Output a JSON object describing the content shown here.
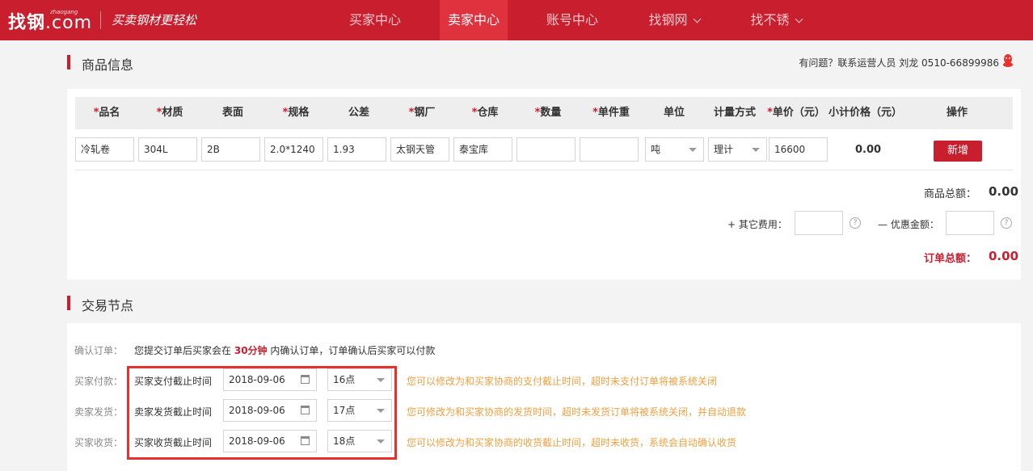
{
  "nav": {
    "logo": "找钢",
    "logo_com": ".com",
    "logo_sub": "zhaogang",
    "slogan": "买卖钢材更轻松",
    "items": [
      {
        "label": "买家中心"
      },
      {
        "label": "卖家中心"
      },
      {
        "label": "账号中心"
      },
      {
        "label": "找钢网"
      },
      {
        "label": "找不锈"
      }
    ]
  },
  "product_section": {
    "title": "商品信息",
    "contact": "有问题？联系运营人员 刘龙 0510-66899986"
  },
  "table": {
    "required_mark": "*",
    "headers": [
      {
        "label": "品名",
        "required": true
      },
      {
        "label": "材质",
        "required": true
      },
      {
        "label": "表面",
        "required": false
      },
      {
        "label": "规格",
        "required": true
      },
      {
        "label": "公差",
        "required": false
      },
      {
        "label": "钢厂",
        "required": true
      },
      {
        "label": "仓库",
        "required": true
      },
      {
        "label": "数量",
        "required": true
      },
      {
        "label": "单件重",
        "required": true
      },
      {
        "label": "单位",
        "required": false
      },
      {
        "label": "计量方式",
        "required": false
      },
      {
        "label": "单价（元）",
        "required": true
      },
      {
        "label": "小计价格（元）",
        "required": false
      },
      {
        "label": "操作",
        "required": false
      }
    ],
    "row": {
      "name": "冷轧卷",
      "material": "304L",
      "surface": "2B",
      "spec": "2.0*1240",
      "tolerance": "1.93",
      "mill": "太钢天管",
      "warehouse": "泰宝库",
      "quantity": "",
      "unit_weight": "",
      "unit": "吨",
      "measure": "理计",
      "price": "16600",
      "subtotal": "0.00",
      "add_button": "新增"
    }
  },
  "totals": {
    "goods_label": "商品总额：",
    "goods_value": "0.00",
    "other_fee_label": "+ 其它费用：",
    "discount_label": "— 优惠金额：",
    "order_label": "订单总额：",
    "order_value": "0.00",
    "help": "?"
  },
  "trade_section": {
    "title": "交易节点",
    "confirm_label": "确认订单：",
    "confirm_text_pre": "您提交订单后买家会在",
    "confirm_text_bold": "30分钟",
    "confirm_text_post": "内确认订单，订单确认后买家可以付款",
    "rows": [
      {
        "label": "买家付款：",
        "name": "买家支付截止时间",
        "date": "2018-09-06",
        "hour": "16点",
        "hint": "您可以修改为和买家协商的支付截止时间，超时未支付订单将被系统关闭"
      },
      {
        "label": "卖家发货：",
        "name": "卖家发货截止时间",
        "date": "2018-09-06",
        "hour": "17点",
        "hint": "您可修改为和买家协商的发货时间，超时未发货订单将被系统关闭，并自动退款"
      },
      {
        "label": "买家收货：",
        "name": "买家收货截止时间",
        "date": "2018-09-06",
        "hour": "18点",
        "hint": "您可以修改为和买家协商的收货截止时间，超时未收货，系统会自动确认收货"
      }
    ]
  }
}
